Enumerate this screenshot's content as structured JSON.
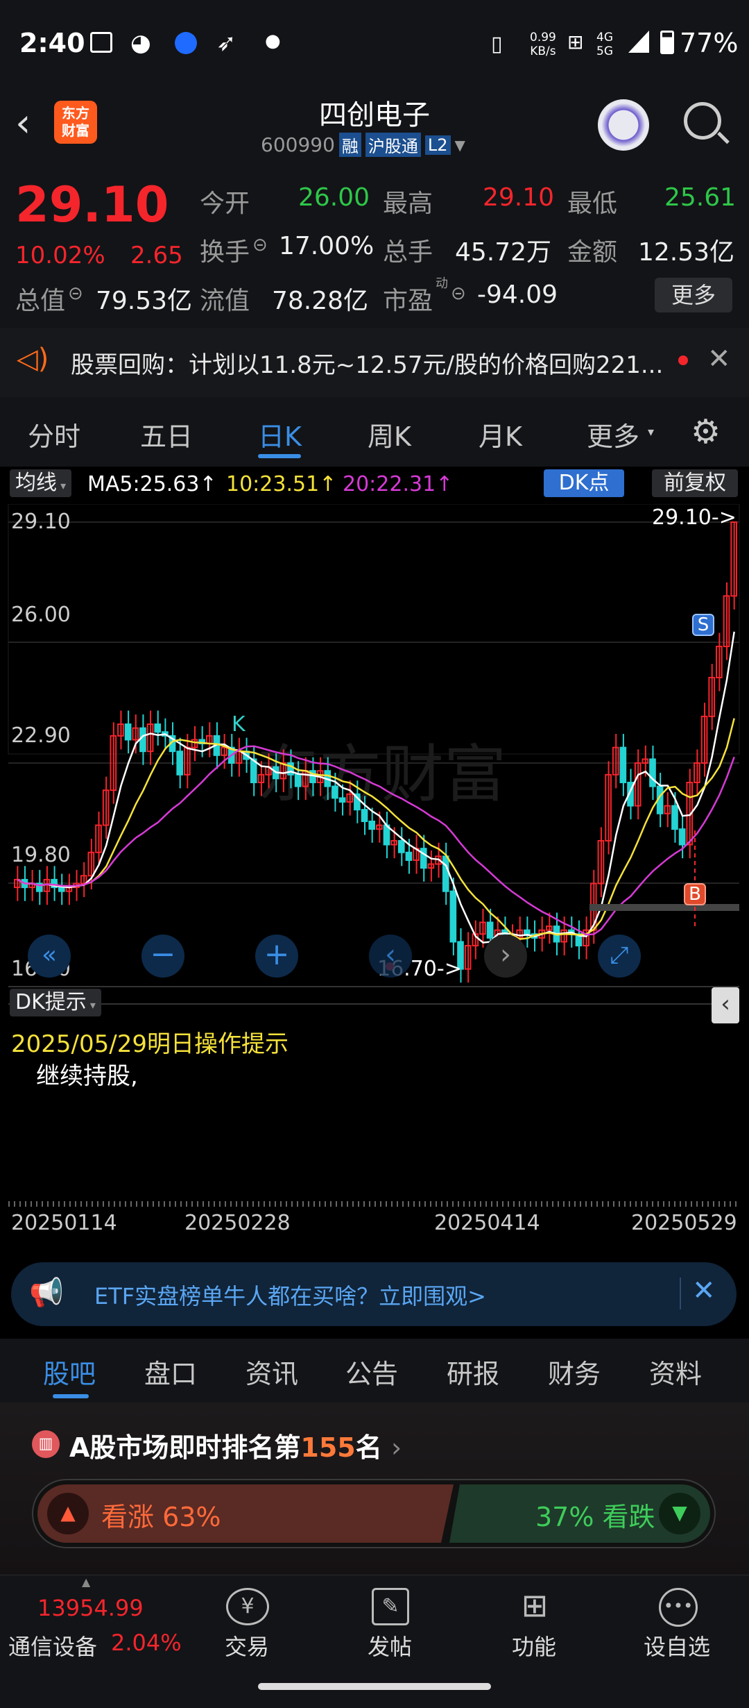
{
  "status_bar": {
    "time": "2:40",
    "speed_value": "0.99",
    "speed_unit": "KB/s",
    "network": "4G\n5G",
    "battery": "77%"
  },
  "header": {
    "title": "四创电子",
    "code": "600990",
    "tag_rong": "融",
    "tag_hgt": "沪股通",
    "tag_l2": "L2",
    "logo_line1": "东方",
    "logo_line2": "财富"
  },
  "quote": {
    "price": "29.10",
    "change_pct": "10.02%",
    "change": "2.65",
    "open_label": "今开",
    "open": "26.00",
    "high_label": "最高",
    "high": "29.10",
    "low_label": "最低",
    "low": "25.61",
    "turnover_label": "换手",
    "turnover": "17.00%",
    "volume_label": "总手",
    "volume": "45.72万",
    "amount_label": "金额",
    "amount": "12.53亿",
    "mcap_label": "总值",
    "mcap": "79.53亿",
    "float_label": "流值",
    "float": "78.28亿",
    "pe_label": "市盈",
    "pe_sup": "动",
    "pe": "-94.09",
    "more": "更多"
  },
  "notice": {
    "text": "股票回购：计划以11.8元~12.57元/股的价格回购221..."
  },
  "k_tabs": [
    "分时",
    "五日",
    "日K",
    "周K",
    "月K",
    "更多"
  ],
  "chart": {
    "ma_selector": "均线",
    "ma5": "MA5:25.63",
    "ma10": "10:23.51",
    "ma20": "20:22.31",
    "dk_button": "DK点",
    "fq_button": "前复权",
    "y_ticks": [
      "29.10",
      "26.00",
      "22.90",
      "19.80",
      "16.70"
    ],
    "max_label": "29.10->",
    "min_label": "16.70->",
    "dk_hint_label": "DK提示",
    "hint_title": "2025/05/29明日操作提示",
    "hint_body": "继续持股,",
    "dates": [
      "20250114",
      "20250228",
      "20250414",
      "20250529"
    ],
    "signal_s": "S",
    "signal_b": "B",
    "signal_k": "K",
    "watermark": "东方财富"
  },
  "chart_data": {
    "type": "candlestick",
    "ylim": [
      16.7,
      29.1
    ],
    "x": [
      "20250114",
      "20250228",
      "20250414",
      "20250529"
    ],
    "series": [
      {
        "name": "MA5",
        "last": 25.63
      },
      {
        "name": "10",
        "last": 23.51
      },
      {
        "name": "20",
        "last": 22.31
      }
    ]
  },
  "etf": {
    "text": "ETF实盘榜单牛人都在买啥？立即围观>"
  },
  "bottom_tabs": [
    "股吧",
    "盘口",
    "资讯",
    "公告",
    "研报",
    "财务",
    "资料"
  ],
  "rank": {
    "prefix": "A股市场即时排名第",
    "number": "155",
    "suffix": "名",
    "up_label": "看涨 63%",
    "down_label": "37% 看跌"
  },
  "bottom_nav": {
    "index_value": "13954.99",
    "index_name": "通信设备",
    "index_change": "2.04%",
    "trade": "交易",
    "post": "发帖",
    "func": "功能",
    "watch": "设自选"
  },
  "colors": {
    "up": "#f5252c",
    "down": "#2ec749",
    "accent": "#3a8ee6",
    "ma5": "#ffffff",
    "ma10": "#f5e23a",
    "ma20": "#d63ad6"
  }
}
